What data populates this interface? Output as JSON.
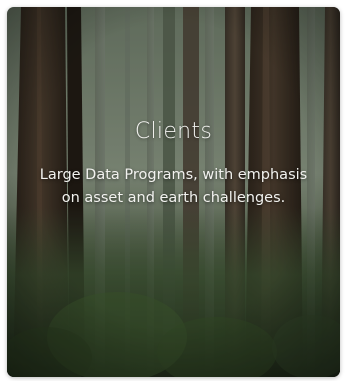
{
  "card": {
    "title": "Clients",
    "description": "Large Data Programs, with emphasis on asset and earth challenges.",
    "background": "redwood-forest-photo"
  },
  "colors": {
    "text": "#f2f2ef",
    "forest_dark": "#2c3729",
    "forest_mist": "#8d9a85"
  }
}
